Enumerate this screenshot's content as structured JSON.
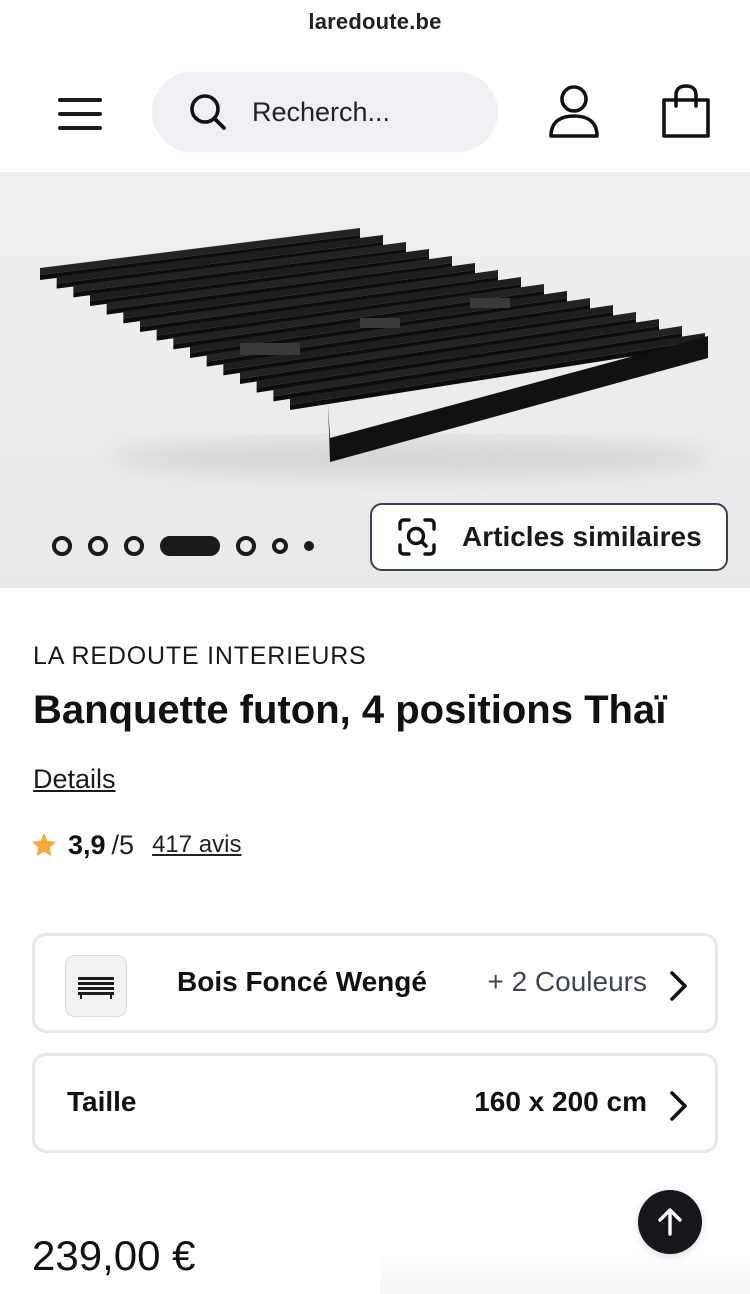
{
  "browser": {
    "url_text": "laredoute.be"
  },
  "header": {
    "menu_icon": "hamburger-menu-icon",
    "search_placeholder": "Recherch...",
    "search_icon": "search-icon",
    "account_icon": "user-icon",
    "cart_icon": "shopping-bag-icon"
  },
  "gallery": {
    "image_count": 7,
    "active_index": 3,
    "similar_button_label": "Articles similaires",
    "similar_icon": "visual-search-icon"
  },
  "product": {
    "brand": "LA REDOUTE INTERIEURS",
    "title": "Banquette futon, 4 positions Thaï",
    "details_link": "Details",
    "rating": {
      "score": "3,9",
      "out_of": "/5",
      "reviews": "417 avis",
      "star_color": "#f3a93b"
    },
    "color_option": {
      "name": "Bois Foncé Wengé",
      "more": "+ 2 Couleurs"
    },
    "size_option": {
      "label": "Taille",
      "value": "160 x 200 cm"
    },
    "price": "239,00 €"
  },
  "colors": {
    "text": "#1a1a1a",
    "search_bg": "#eef0f4",
    "gallery_bg": "#ececed",
    "border": "#e6e7ea",
    "fab_bg": "#16171b"
  }
}
